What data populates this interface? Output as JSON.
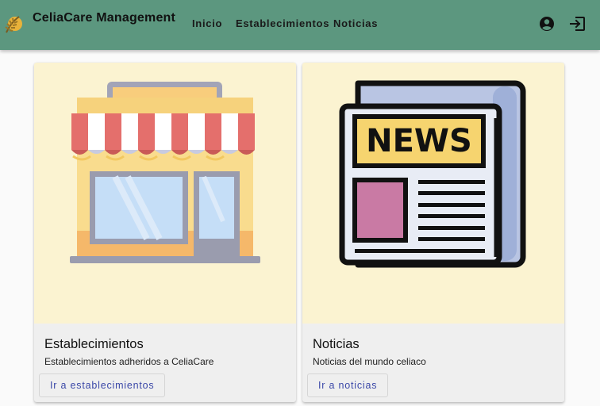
{
  "app": {
    "title": "CeliaCare Management"
  },
  "nav": {
    "items": [
      "Inicio",
      "Establecimientos",
      "Noticias"
    ]
  },
  "icons": {
    "logo": "wheat-logo-icon",
    "account": "account-circle-icon",
    "logout": "logout-icon"
  },
  "cards": [
    {
      "title": "Establecimientos",
      "description": "Establecimientos adheridos a CeliaCare",
      "action": "Ir a establecimientos",
      "image": "store-icon"
    },
    {
      "title": "Noticias",
      "description": "Noticias del mundo celiaco",
      "action": "Ir a noticias",
      "image": "newspaper-icon"
    }
  ],
  "colors": {
    "toolbar": "#5c977f",
    "card_media": "#fbf3d1",
    "card_body": "#efefef",
    "action_text": "#3b48a8"
  }
}
